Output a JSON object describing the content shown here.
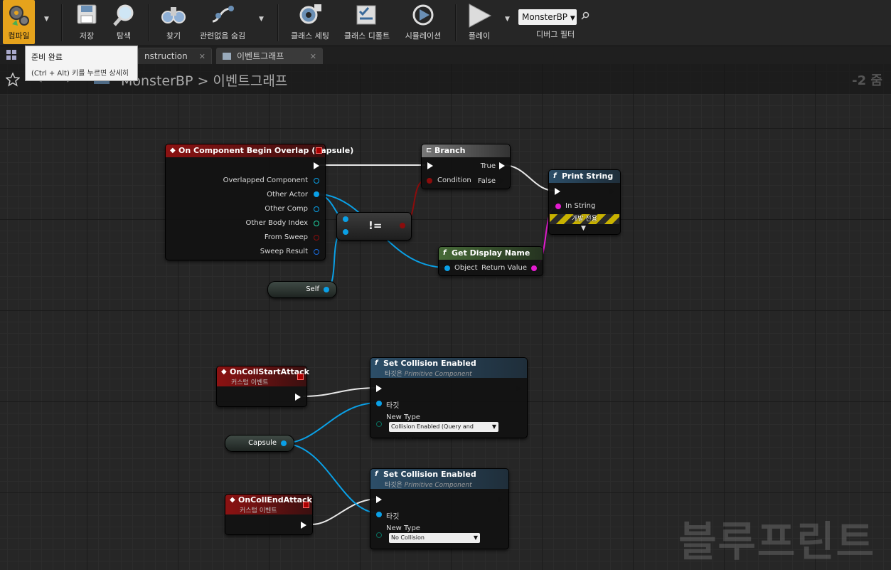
{
  "toolbar": {
    "compile": "컴파일",
    "save": "저장",
    "browse": "탐색",
    "find": "찾기",
    "hide_unrelated": "관련없음 숨김",
    "class_settings": "클래스 세팅",
    "class_defaults": "클래스 디폴트",
    "simulation": "시뮬레이션",
    "play": "플레이",
    "debug_object": "MonsterBP",
    "debug_filter": "디버그 필터"
  },
  "tooltip": {
    "title": "준비 완료",
    "hint": "(Ctrl + Alt) 키를 누르면 상세히"
  },
  "tabs": [
    {
      "label": "nstruction Scrip"
    },
    {
      "label": "이벤트그래프"
    }
  ],
  "breadcrumb": {
    "path": "MonsterBP > 이벤트그래프"
  },
  "zoom": "-2 줌",
  "watermark": "블루프린트",
  "nodes": {
    "overlap": {
      "title": "On Component Begin Overlap (Capsule)",
      "pins": [
        "Overlapped Component",
        "Other Actor",
        "Other Comp",
        "Other Body Index",
        "From Sweep",
        "Sweep Result"
      ]
    },
    "branch": {
      "title": "Branch",
      "condition": "Condition",
      "true": "True",
      "false": "False"
    },
    "print": {
      "title": "Print String",
      "in_string": "In String",
      "dev_only": "개발 전용"
    },
    "not_equal": {
      "label": "!="
    },
    "display_name": {
      "title": "Get Display Name",
      "object": "Object",
      "return": "Return Value"
    },
    "self": {
      "label": "Self"
    },
    "start_attack": {
      "title": "OnCollStartAttack",
      "subtitle": "커스텀 이벤트"
    },
    "end_attack": {
      "title": "OnCollEndAttack",
      "subtitle": "커스텀 이벤트"
    },
    "capsule": {
      "label": "Capsule"
    },
    "set_coll_1": {
      "title": "Set Collision Enabled",
      "subtitle_prefix": "타깃은",
      "subtitle_class": "Primitive Component",
      "target": "타깃",
      "new_type": "New Type",
      "value": "Collision Enabled (Query and Physics)"
    },
    "set_coll_2": {
      "title": "Set Collision Enabled",
      "subtitle_prefix": "타깃은",
      "subtitle_class": "Primitive Component",
      "target": "타깃",
      "new_type": "New Type",
      "value": "No Collision"
    }
  }
}
